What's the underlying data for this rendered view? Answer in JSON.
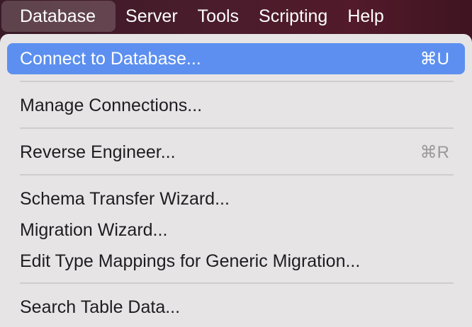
{
  "menubar": {
    "items": [
      {
        "label": "Database"
      },
      {
        "label": "Server"
      },
      {
        "label": "Tools"
      },
      {
        "label": "Scripting"
      },
      {
        "label": "Help"
      }
    ]
  },
  "database_menu": {
    "items": [
      {
        "label": "Connect to Database...",
        "shortcut": "⌘U",
        "highlighted": true
      },
      {
        "label": "Manage Connections..."
      },
      {
        "label": "Reverse Engineer...",
        "shortcut": "⌘R"
      },
      {
        "label": "Schema Transfer Wizard..."
      },
      {
        "label": "Migration Wizard..."
      },
      {
        "label": "Edit Type Mappings for Generic Migration..."
      },
      {
        "label": "Search Table Data..."
      }
    ]
  },
  "colors": {
    "highlight": "#5c8ff0",
    "menu_background": "#e7e4e6",
    "menubar_background": "#4a1c2c"
  }
}
